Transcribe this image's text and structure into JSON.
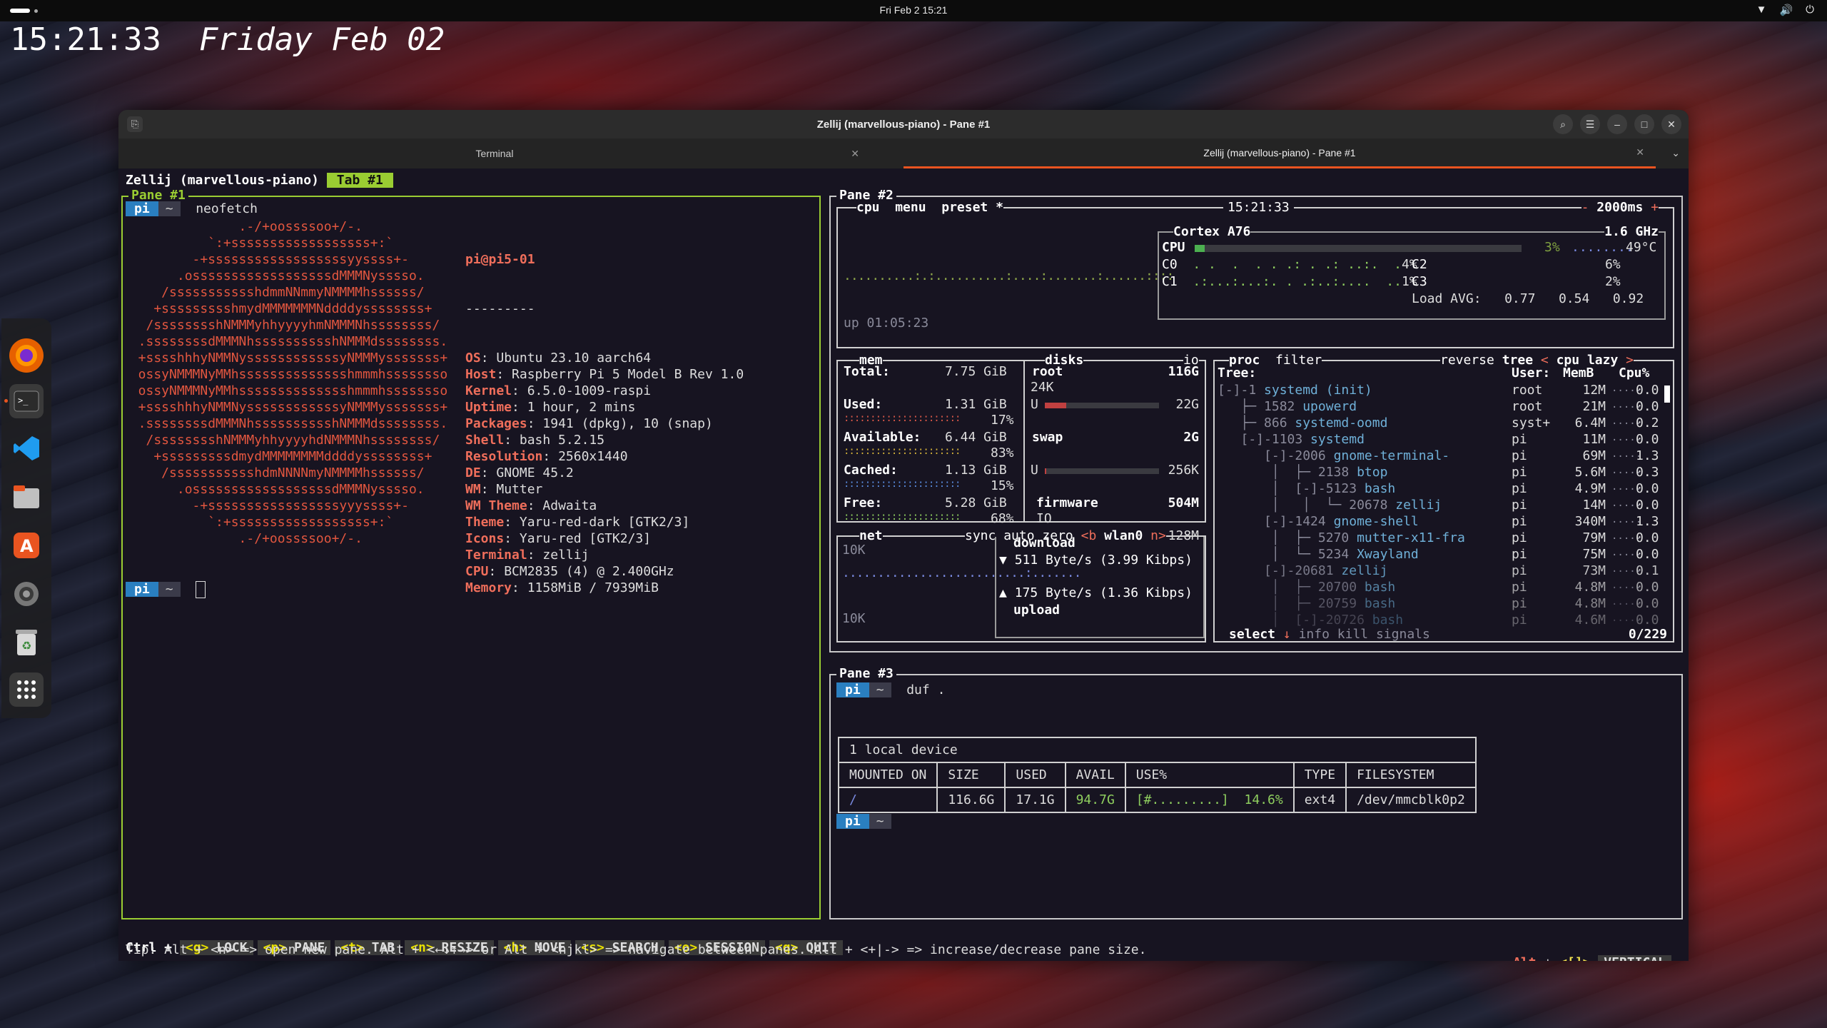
{
  "topbar": {
    "clock": "Fri Feb 2  15:21",
    "tray": [
      "wifi-icon",
      "volume-icon",
      "power-icon"
    ]
  },
  "desktop_clock": {
    "time": "15:21:33",
    "date": "Friday Feb 02"
  },
  "dock": {
    "apps": [
      "firefox-icon",
      "terminal-icon",
      "vscode-icon",
      "files-icon",
      "app-center-icon",
      "settings-icon",
      "trash-icon",
      "app-grid-icon"
    ]
  },
  "window": {
    "title": "Zellij (marvellous-piano) - Pane #1",
    "tabs": [
      {
        "label": "Terminal"
      },
      {
        "label": "Zellij (marvellous-piano) - Pane #1"
      }
    ]
  },
  "zellij": {
    "session": "Zellij (marvellous-piano)",
    "tab": "Tab #1",
    "pane1": "Pane #1",
    "pane2": "Pane #2",
    "pane3": "Pane #3",
    "prompt_user": "pi",
    "prompt_dir": "~"
  },
  "neofetch": {
    "command": "neofetch",
    "userhost": "pi@pi5-01",
    "sep": "---------",
    "info": [
      {
        "k": "OS",
        "v": "Ubuntu 23.10 aarch64"
      },
      {
        "k": "Host",
        "v": "Raspberry Pi 5 Model B Rev 1.0"
      },
      {
        "k": "Kernel",
        "v": "6.5.0-1009-raspi"
      },
      {
        "k": "Uptime",
        "v": "1 hour, 2 mins"
      },
      {
        "k": "Packages",
        "v": "1941 (dpkg), 10 (snap)"
      },
      {
        "k": "Shell",
        "v": "bash 5.2.15"
      },
      {
        "k": "Resolution",
        "v": "2560x1440"
      },
      {
        "k": "DE",
        "v": "GNOME 45.2"
      },
      {
        "k": "WM",
        "v": "Mutter"
      },
      {
        "k": "WM Theme",
        "v": "Adwaita"
      },
      {
        "k": "Theme",
        "v": "Yaru-red-dark [GTK2/3]"
      },
      {
        "k": "Icons",
        "v": "Yaru-red [GTK2/3]"
      },
      {
        "k": "Terminal",
        "v": "zellij"
      },
      {
        "k": "CPU",
        "v": "BCM2835 (4) @ 2.400GHz"
      },
      {
        "k": "Memory",
        "v": "1158MiB / 7939MiB"
      }
    ],
    "logo": [
      "               .-/+oossssoo+/-.",
      "           `:+ssssssssssssssssss+:`",
      "         -+ssssssssssssssssssyyssss+-",
      "       .ossssssssssssssssssdMMMNysssso.",
      "     /ssssssssssshdmmNNmmyNMMMMhssssss/",
      "    +ssssssssshmydMMMMMMMNddddyssssssss+",
      "   /sssssssshNMMMyhhyyyyhmNMMMNhssssssss/",
      "  .ssssssssdMMMNhsssssssssshNMMMdssssssss.",
      "  +sssshhhyNMMNyssssssssssssyNMMMysssssss+",
      "  ossyNMMMNyMMhsssssssssssssshmmmhssssssso",
      "  ossyNMMMNyMMhsssssssssssssshmmmhssssssso",
      "  +sssshhhyNMMNyssssssssssssyNMMMysssssss+",
      "  .ssssssssdMMMNhsssssssssshNMMMdssssssss.",
      "   /sssssssshNMMMyhhyyyyhdNMMMNhssssssss/",
      "    +sssssssssdmydMMMMMMMMddddyssssssss+",
      "     /ssssssssssshdmNNNNmyNMMMMhssssss/",
      "       .ossssssssssssssssssdMMMNysssso.",
      "         -+sssssssssssssssssyyyssss+-",
      "           `:+ssssssssssssssssss+:`",
      "               .-/+oossssoo+/-."
    ]
  },
  "btop": {
    "cpu_tab": "cpu",
    "menu": "menu",
    "preset": "preset *",
    "clock": "15:21:33",
    "interval": "2000ms",
    "uptime": "up 01:05:23",
    "cpu_model": "Cortex A76",
    "cpu_freq": "1.6 GHz",
    "cpu_total": {
      "label": "CPU",
      "pct": "3%",
      "temp": "49°C",
      "fill": 0.03
    },
    "cores": [
      {
        "label": "C0",
        "pct": "4%"
      },
      {
        "label": "C1",
        "pct": "1%"
      },
      {
        "label": "C2",
        "pct": "6%"
      },
      {
        "label": "C3",
        "pct": "2%"
      }
    ],
    "load_avg": {
      "label": "Load AVG:",
      "v1": "0.77",
      "v5": "0.54",
      "v15": "0.92"
    },
    "mem": {
      "title": "mem",
      "rows": [
        {
          "k": "Total:",
          "v": "7.75 GiB",
          "pct": ""
        },
        {
          "k": "Used:",
          "v": "1.31 GiB",
          "pct": "17%"
        },
        {
          "k": "Available:",
          "v": "6.44 GiB",
          "pct": "83%"
        },
        {
          "k": "Cached:",
          "v": "1.13 GiB",
          "pct": "15%"
        },
        {
          "k": "Free:",
          "v": "5.28 GiB",
          "pct": "68%"
        }
      ]
    },
    "disks": {
      "title": "disks",
      "io": "io",
      "items": [
        {
          "name": "root",
          "size": "116G",
          "sub": "24K",
          "used_label": "U",
          "used": "22G",
          "fill": 0.19
        },
        {
          "name": "swap",
          "size": "2G",
          "sub": "",
          "used_label": "U",
          "used": "256K",
          "fill": 0.01
        },
        {
          "name": "firmware",
          "size": "504M",
          "sub": "IO",
          "used_label": "U",
          "used": "128M",
          "fill": 0.25
        }
      ]
    },
    "net": {
      "title": "net",
      "sync": "sync",
      "auto": "auto",
      "zero": "zero",
      "iface_prev": "<b",
      "iface": "wlan0",
      "iface_next": "n>",
      "scale_top": "10K",
      "scale_bottom": "10K",
      "download_label": "download",
      "download": "511 Byte/s (3.99 Kibps)",
      "upload_label": "upload",
      "upload": "175 Byte/s (1.36 Kibps)"
    },
    "proc": {
      "title": "proc",
      "filter": "filter",
      "reverse": "reverse",
      "tree": "tree",
      "sort": "cpu lazy",
      "headers": {
        "tree": "Tree:",
        "user": "User:",
        "mem": "MemB",
        "cpu": "Cpu%"
      },
      "rows": [
        {
          "tree": "[-]-1 ",
          "name": "systemd (init)",
          "user": "root",
          "mem": "12M",
          "cpu": "0.0"
        },
        {
          "tree": "   ├─ 1582 ",
          "name": "upowerd",
          "user": "root",
          "mem": "21M",
          "cpu": "0.0"
        },
        {
          "tree": "   ├─ 866 ",
          "name": "systemd-oomd",
          "user": "syst+",
          "mem": "6.4M",
          "cpu": "0.2"
        },
        {
          "tree": "   [-]-1103 ",
          "name": "systemd",
          "user": "pi",
          "mem": "11M",
          "cpu": "0.0"
        },
        {
          "tree": "      [-]-2006 ",
          "name": "gnome-terminal-",
          "user": "pi",
          "mem": "69M",
          "cpu": "1.3"
        },
        {
          "tree": "       │  ├─ 2138 ",
          "name": "btop",
          "user": "pi",
          "mem": "5.6M",
          "cpu": "0.3"
        },
        {
          "tree": "       │  [-]-5123 ",
          "name": "bash",
          "user": "pi",
          "mem": "4.9M",
          "cpu": "0.0"
        },
        {
          "tree": "       │   │  └─ 20678 ",
          "name": "zellij",
          "user": "pi",
          "mem": "14M",
          "cpu": "0.0"
        },
        {
          "tree": "      [-]-1424 ",
          "name": "gnome-shell",
          "user": "pi",
          "mem": "340M",
          "cpu": "1.3"
        },
        {
          "tree": "       │  ├─ 5270 ",
          "name": "mutter-x11-fra",
          "user": "pi",
          "mem": "79M",
          "cpu": "0.0"
        },
        {
          "tree": "       │  └─ 5234 ",
          "name": "Xwayland",
          "user": "pi",
          "mem": "75M",
          "cpu": "0.0"
        },
        {
          "tree": "      [-]-20681 ",
          "name": "zellij",
          "user": "pi",
          "mem": "73M",
          "cpu": "0.1"
        },
        {
          "tree": "       │  ├─ 20700 ",
          "name": "bash",
          "user": "pi",
          "mem": "4.8M",
          "cpu": "0.0"
        },
        {
          "tree": "       │  ├─ 20759 ",
          "name": "bash",
          "user": "pi",
          "mem": "4.8M",
          "cpu": "0.0"
        },
        {
          "tree": "       │  [-]-20726 ",
          "name": "bash",
          "user": "pi",
          "mem": "4.6M",
          "cpu": "0.0"
        }
      ],
      "footer": {
        "select": "select",
        "info": "info",
        "kill": "kill",
        "signals": "signals",
        "count": "0/229"
      }
    }
  },
  "duf": {
    "command": "duf .",
    "title": "1 local device",
    "headers": [
      "MOUNTED ON",
      "SIZE",
      "USED",
      "AVAIL",
      "USE%",
      "TYPE",
      "FILESYSTEM"
    ],
    "row": {
      "mount": "/",
      "size": "116.6G",
      "used": "17.1G",
      "avail": "94.7G",
      "bar": "[#.........]",
      "pct": "14.6%",
      "type": "ext4",
      "fs": "/dev/mmcblk0p2"
    }
  },
  "statusbar": {
    "ctrl": "Ctrl +",
    "keys": [
      {
        "key": "<g>",
        "label": "LOCK"
      },
      {
        "key": "<p>",
        "label": "PANE"
      },
      {
        "key": "<t>",
        "label": "TAB"
      },
      {
        "key": "<n>",
        "label": "RESIZE"
      },
      {
        "key": "<h>",
        "label": "MOVE"
      },
      {
        "key": "<s>",
        "label": "SEARCH"
      },
      {
        "key": "<o>",
        "label": "SESSION"
      },
      {
        "key": "<q>",
        "label": "QUIT"
      }
    ],
    "right_mod": "Alt",
    "right_key": "<[]>",
    "right_label": "VERTICAL",
    "tip": "Tip: Alt + <n> => open new pane. Alt + <←↓↑→> or Alt + <hjkl> => navigate between panes. Alt + <+|-> => increase/decrease pane size."
  }
}
